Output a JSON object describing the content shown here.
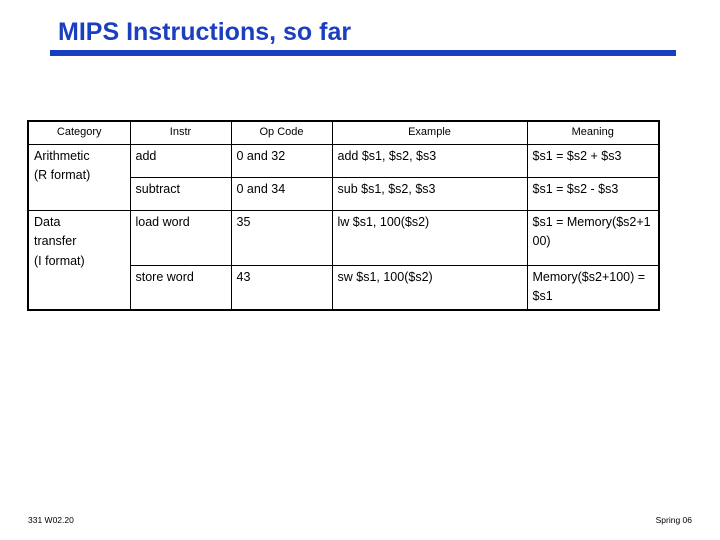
{
  "slide": {
    "title": "MIPS Instructions, so far",
    "accent_color": "#1740c0",
    "title_color": "#1b3fbf"
  },
  "table": {
    "headers": {
      "category": "Category",
      "instr": "Instr",
      "opcode": "Op Code",
      "example": "Example",
      "meaning": "Meaning"
    },
    "categories": [
      {
        "line1": "Arithmetic",
        "line2": "(R format)"
      },
      {
        "line1": "Data",
        "line2": "transfer",
        "line3": "(I format)"
      }
    ],
    "rows": [
      {
        "instr": "add",
        "opcode": "0 and 32",
        "example": "add  $s1, $s2, $s3",
        "meaning": "$s1 = $s2 + $s3"
      },
      {
        "instr": "subtract",
        "opcode": "0 and 34",
        "example": "sub  $s1, $s2, $s3",
        "meaning": "$s1 = $s2 - $s3"
      },
      {
        "instr": "load word",
        "opcode": "35",
        "example": "lw   $s1, 100($s2)",
        "meaning": "$s1 = Memory($s2+100)"
      },
      {
        "instr": "store word",
        "opcode": "43",
        "example": "sw   $s1, 100($s2)",
        "meaning": "Memory($s2+100) = $s1"
      }
    ]
  },
  "footer": {
    "left": "331  W02.20",
    "right": "Spring 06"
  }
}
